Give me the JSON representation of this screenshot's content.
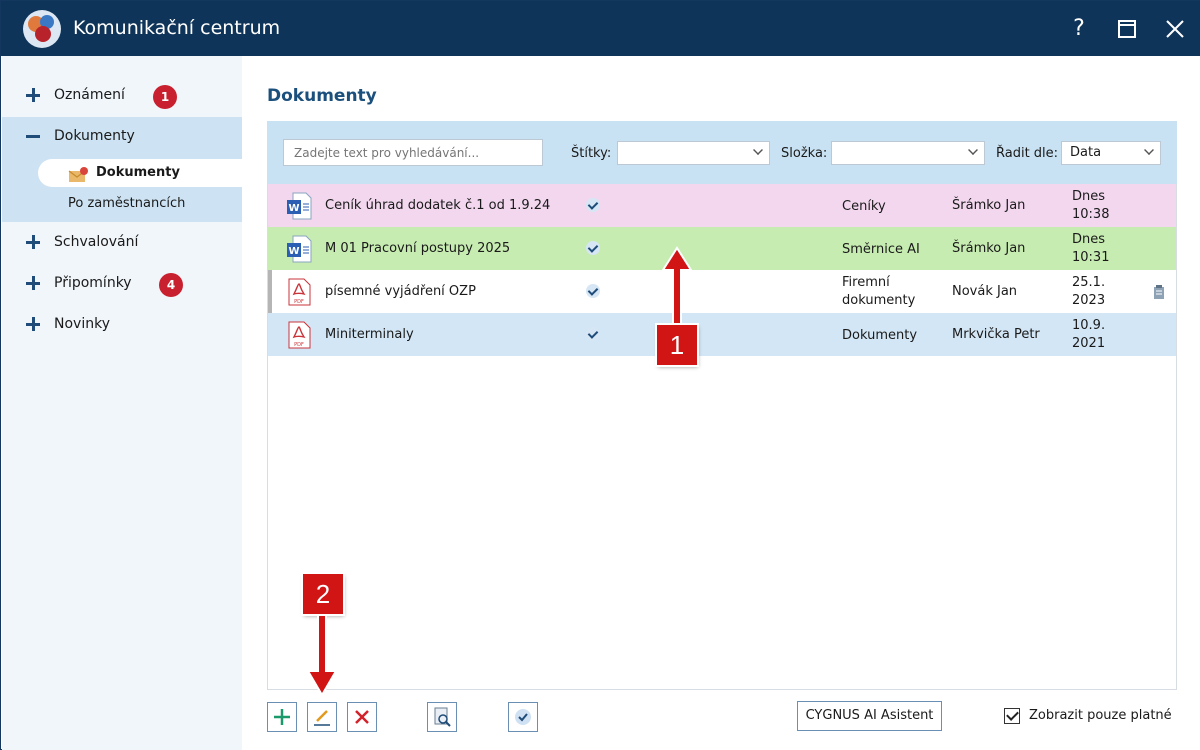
{
  "app": {
    "title": "Komunikační centrum"
  },
  "window_controls": {
    "help": "?"
  },
  "sidebar": {
    "items": [
      {
        "label": "Oznámení",
        "badge": "1",
        "state": "collapsed"
      },
      {
        "label": "Dokumenty",
        "state": "expanded"
      },
      {
        "label": "Schvalování",
        "state": "collapsed"
      },
      {
        "label": "Připomínky",
        "badge": "4",
        "state": "collapsed"
      },
      {
        "label": "Novinky",
        "state": "collapsed"
      }
    ],
    "sub_items": [
      {
        "label": "Dokumenty",
        "active": true
      },
      {
        "label": "Po zaměstnancích"
      }
    ]
  },
  "main": {
    "title": "Dokumenty",
    "filters": {
      "search_placeholder": "Zadejte text pro vyhledávání...",
      "tags_label": "Štítky:",
      "tags_value": "",
      "folder_label": "Složka:",
      "folder_value": "",
      "sort_label": "Řadit dle:",
      "sort_value": "Data"
    },
    "rows": [
      {
        "icon": "word-icon",
        "name": "Ceník úhrad dodatek č.1 od 1.9.24",
        "checked": true,
        "folder": "Ceníky",
        "author": "Šrámko Jan",
        "date1": "Dnes",
        "date2": "10:38",
        "color": "#f2d7ef"
      },
      {
        "icon": "word-icon",
        "name": "M 01 Pracovní postupy 2025",
        "checked": true,
        "folder": "Směrnice AI",
        "author": "Šrámko Jan",
        "date1": "Dnes",
        "date2": "10:31",
        "color": "#c7ecb1"
      },
      {
        "icon": "pdf-icon",
        "name": "písemné vyjádření OZP",
        "checked": true,
        "folder1": "Firemní",
        "folder2": "dokumenty",
        "author": "Novák Jan",
        "date1": "25.1.",
        "date2": "2023",
        "color": "#ffffff"
      },
      {
        "icon": "pdf-icon",
        "name": "Miniterminaly",
        "checked": true,
        "folder": "Dokumenty",
        "author": "Mrkvička Petr",
        "date1": "10.9.",
        "date2": "2021",
        "color": "#d3e6f5"
      }
    ],
    "toolbar": {
      "ai_button": "CYGNUS AI Asistent",
      "show_valid_label": "Zobrazit pouze platné",
      "show_valid_checked": true
    }
  },
  "annotations": {
    "callout_1": "1",
    "callout_2": "2",
    "color": "#d11414"
  }
}
